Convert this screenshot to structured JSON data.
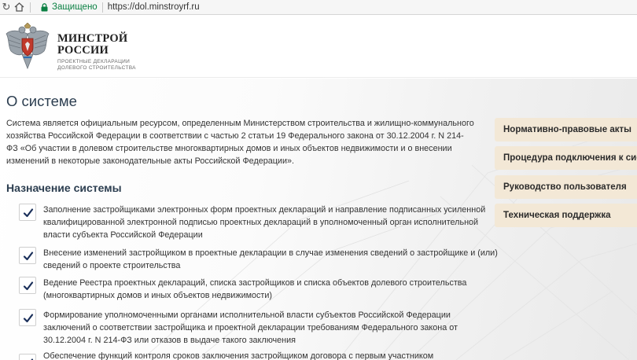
{
  "browser": {
    "secure_label": "Защищено",
    "url": "https://dol.minstroyrf.ru"
  },
  "header": {
    "brand_line1": "МИНСТРОЙ",
    "brand_line2": "РОССИИ",
    "sub_line1": "ПРОЕКТНЫЕ ДЕКЛАРАЦИИ",
    "sub_line2": "ДОЛЕВОГО СТРОИТЕЛЬСТВА"
  },
  "content": {
    "title": "О системе",
    "intro": "Система является официальным ресурсом, определенным Министерством строительства и жилищно-коммунального хозяйства Российской Федерации в соответствии с частью 2 статьи 19 Федерального закона от 30.12.2004 г. N 214-ФЗ «Об участии в долевом строительстве многоквартирных домов и иных объектов недвижимости и о внесении изменений в некоторые законодательные акты Российской Федерации».",
    "purpose_title": "Назначение системы",
    "purpose_items": [
      "Заполнение застройщиками электронных форм проектных деклараций и направление подписанных усиленной квалифицированной электронной подписью проектных деклараций в уполномоченный орган исполнительной власти субъекта Российской Федерации",
      "Внесение изменений застройщиком в проектные декларации в случае изменения сведений о застройщике и (или) сведений о проекте строительства",
      "Ведение Реестра проектных деклараций, списка застройщиков и списка объектов долевого строительства (многоквартирных домов и иных объектов недвижимости)",
      "Формирование уполномоченными органами исполнительной власти субъектов Российской Федерации заключений о соответствии застройщика и проектной декларации требованиям Федерального закона от 30.12.2004 г. N 214-ФЗ или отказов в выдаче такого заключения",
      "Обеспечение функций контроля сроков заключения застройщиком договора с первым участником"
    ]
  },
  "sidebar": {
    "links": [
      "Нормативно-правовые акты",
      "Процедура подключения к системе",
      "Руководство пользователя",
      "Техническая поддержка"
    ]
  }
}
